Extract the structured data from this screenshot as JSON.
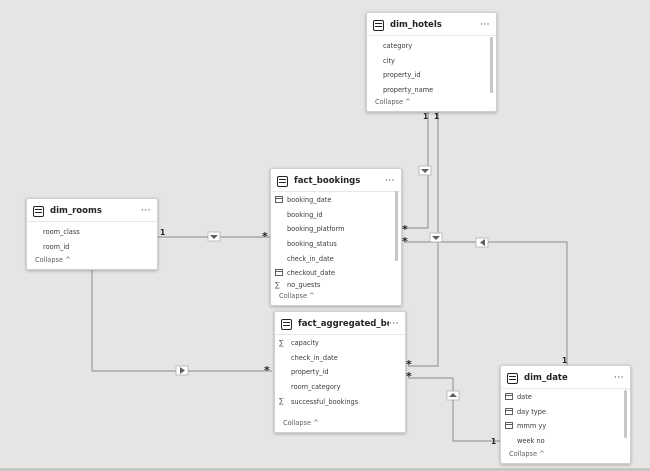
{
  "colors": {
    "canvas": "#e6e5e3",
    "card": "#ffffff",
    "line": "#9c9c9c"
  },
  "tables": {
    "dim_hotels": {
      "title": "dim_hotels",
      "fields": [
        {
          "name": "category",
          "icon": ""
        },
        {
          "name": "city",
          "icon": ""
        },
        {
          "name": "property_id",
          "icon": ""
        },
        {
          "name": "property_name",
          "icon": ""
        }
      ],
      "collapse": "Collapse ^"
    },
    "fact_bookings": {
      "title": "fact_bookings",
      "fields": [
        {
          "name": "booking_date",
          "icon": "calendar-icon"
        },
        {
          "name": "booking_id",
          "icon": ""
        },
        {
          "name": "booking_platform",
          "icon": ""
        },
        {
          "name": "booking_status",
          "icon": ""
        },
        {
          "name": "check_in_date",
          "icon": ""
        },
        {
          "name": "checkout_date",
          "icon": "calendar-icon"
        },
        {
          "name": "no_guests",
          "icon": "sigma-icon"
        }
      ],
      "collapse": "Collapse ^"
    },
    "dim_rooms": {
      "title": "dim_rooms",
      "fields": [
        {
          "name": "room_class",
          "icon": ""
        },
        {
          "name": "room_id",
          "icon": ""
        }
      ],
      "collapse": "Collapse ^"
    },
    "fact_aggregated": {
      "title": "fact_aggregated_booki...",
      "fields": [
        {
          "name": "capacity",
          "icon": "sigma-icon"
        },
        {
          "name": "check_in_date",
          "icon": ""
        },
        {
          "name": "property_id",
          "icon": ""
        },
        {
          "name": "room_category",
          "icon": ""
        },
        {
          "name": "successful_bookings",
          "icon": "sigma-icon"
        }
      ],
      "collapse": "Collapse ^"
    },
    "dim_date": {
      "title": "dim_date",
      "fields": [
        {
          "name": "date",
          "icon": "calendar-icon"
        },
        {
          "name": "day type",
          "icon": "text-icon"
        },
        {
          "name": "mmm yy",
          "icon": "calendar-icon"
        },
        {
          "name": "week no",
          "icon": ""
        }
      ],
      "collapse": "Collapse ^"
    }
  },
  "more_label": "···",
  "relationships": {
    "one": "1",
    "many": "*"
  }
}
